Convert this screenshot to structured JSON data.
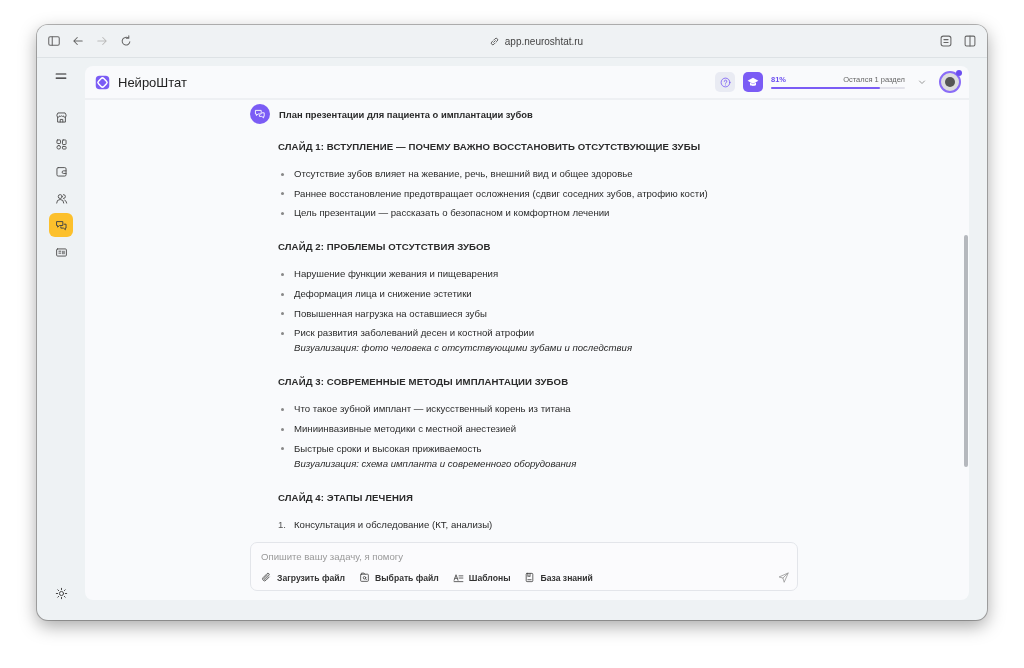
{
  "browser": {
    "url": "app.neuroshtat.ru"
  },
  "sidebar": {
    "items": [
      {
        "kind": "store",
        "selected": false
      },
      {
        "kind": "grid",
        "selected": false
      },
      {
        "kind": "wallet",
        "selected": false
      },
      {
        "kind": "users",
        "selected": false
      },
      {
        "kind": "chat",
        "selected": true
      },
      {
        "kind": "card",
        "selected": false
      }
    ]
  },
  "header": {
    "brand": "НейроШтат",
    "progress": {
      "reading": "81%",
      "label": "Остался 1 раздел",
      "level": 0.81
    },
    "avatar": {
      "notification": true
    }
  },
  "chat": {
    "title": "План презентации для пациента о имплантации зубов",
    "slides": [
      {
        "title": "СЛАЙД 1: ВСТУПЛЕНИЕ — ПОЧЕМУ ВАЖНО ВОССТАНОВИТЬ ОТСУТСТВУЮЩИЕ ЗУБЫ",
        "kind": "bullet",
        "items": [
          {
            "text": "Отсутствие зубов влияет на жевание, речь, внешний вид и общее здоровье"
          },
          {
            "text": "Раннее восстановление предотвращает осложнения (сдвиг соседних зубов, атрофию кости)"
          },
          {
            "text": "Цель презентации — рассказать о безопасном и комфортном лечении"
          }
        ]
      },
      {
        "title": "СЛАЙД 2: ПРОБЛЕМЫ ОТСУТСТВИЯ ЗУБОВ",
        "kind": "bullet",
        "items": [
          {
            "text": "Нарушение функции жевания и пищеварения"
          },
          {
            "text": "Деформация лица и снижение эстетики"
          },
          {
            "text": "Повышенная нагрузка на оставшиеся зубы"
          },
          {
            "text": "Риск развития заболеваний десен и костной атрофии",
            "note": "Визуализация: фото человека с отсутствующими зубами и последствия"
          }
        ]
      },
      {
        "title": "СЛАЙД 3: СОВРЕМЕННЫЕ МЕТОДЫ ИМПЛАНТАЦИИ ЗУБОВ",
        "kind": "bullet",
        "items": [
          {
            "text": "Что такое зубной имплант — искусственный корень из титана"
          },
          {
            "text": "Миниинвазивные методики с местной анестезией"
          },
          {
            "text": "Быстрые сроки и высокая приживаемость",
            "note": "Визуализация: схема импланта и современного оборудования"
          }
        ]
      },
      {
        "title": "СЛАЙД 4: ЭТАПЫ ЛЕЧЕНИЯ",
        "kind": "numbered",
        "items": [
          {
            "number": "1.",
            "text": "Консультация и обследование (КТ, анализы)"
          }
        ]
      }
    ]
  },
  "composer": {
    "placeholder": "Опишите вашу задачу, я помогу",
    "actions": [
      {
        "kind": "attach",
        "label": "Загрузить файл"
      },
      {
        "kind": "pick",
        "label": "Выбрать файл"
      },
      {
        "kind": "templates",
        "label": "Шаблоны"
      },
      {
        "kind": "knowledge",
        "label": "База знаний"
      }
    ]
  }
}
